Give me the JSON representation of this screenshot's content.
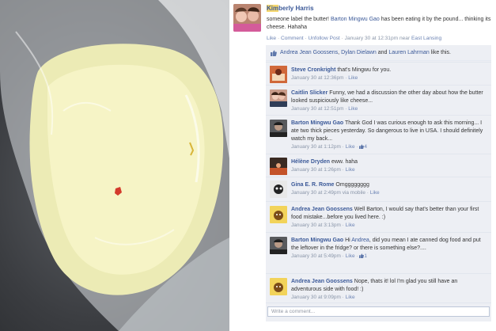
{
  "post": {
    "author_first": "Kim",
    "author_rest": "berly Harris",
    "text_before": "someone label the butter!",
    "mention": "Barton Mingwu Gao",
    "text_after": "has been eating it by the pound... thinking its cheese. Hahaha",
    "actions": {
      "like": "Like",
      "comment": "Comment",
      "unfollow": "Unfollow Post",
      "timestamp": "January 30 at 12:31pm",
      "location_prefix": "near",
      "location": "East Lansing"
    }
  },
  "likes": {
    "names": [
      "Andrea Jean Goossens",
      "Dylan Dielawn",
      "Lauren Lahrman"
    ],
    "sep1": ", ",
    "sep2": " and ",
    "suffix": " like this."
  },
  "comments": [
    {
      "author": "Steve Cronkright",
      "text": "that's Mingwu for you.",
      "time": "January 30 at 12:36pm",
      "via": "",
      "like": "Like",
      "likes": ""
    },
    {
      "author": "Caitlin Slicker",
      "text": "Funny, we had a discussion the other day about how the butter looked suspiciously like cheese...",
      "time": "January 30 at 12:51pm",
      "via": "",
      "like": "Like",
      "likes": ""
    },
    {
      "author": "Barton Mingwu Gao",
      "text": "Thank God I was curious enough to ask this morning... I ate two thick pieces yesterday. So dangerous to live in USA. I should definitely watch my back...",
      "time": "January 30 at 1:12pm",
      "via": "",
      "like": "Like",
      "likes": "4"
    },
    {
      "author": "Hélène Dryden",
      "text": "eww. haha",
      "time": "January 30 at 1:26pm",
      "via": "",
      "like": "Like",
      "likes": ""
    },
    {
      "author": "Gina E. R. Rome",
      "text": "Omgggggggg",
      "time": "January 30 at 2:49pm",
      "via": "via mobile",
      "like": "Like",
      "likes": ""
    },
    {
      "author": "Andrea Jean Goossens",
      "text": "Well Barton, I would say that's better than your first food mistake...before you lived here. :)",
      "time": "January 30 at 3:13pm",
      "via": "",
      "like": "Like",
      "likes": ""
    },
    {
      "author": "Barton Mingwu Gao",
      "mention": "Andrea",
      "text": ", did you mean I ate canned dog food and put the leftover in the fridge? or there is something else?....",
      "prefix": "Hi ",
      "time": "January 30 at 5:49pm",
      "via": "",
      "like": "Like",
      "likes": "1"
    },
    {
      "author": "Andrea Jean Goossens",
      "text": "Nope, thats it! lol I'm glad you still have an adventurous side with food! :)",
      "time": "January 30 at 9:09pm",
      "via": "",
      "like": "Like",
      "likes": ""
    }
  ],
  "write_comment": {
    "placeholder": "Write a comment..."
  },
  "colors": {
    "link": "#3b5998",
    "ufi_bg": "#edeff4",
    "highlight": "#f5d76e"
  }
}
